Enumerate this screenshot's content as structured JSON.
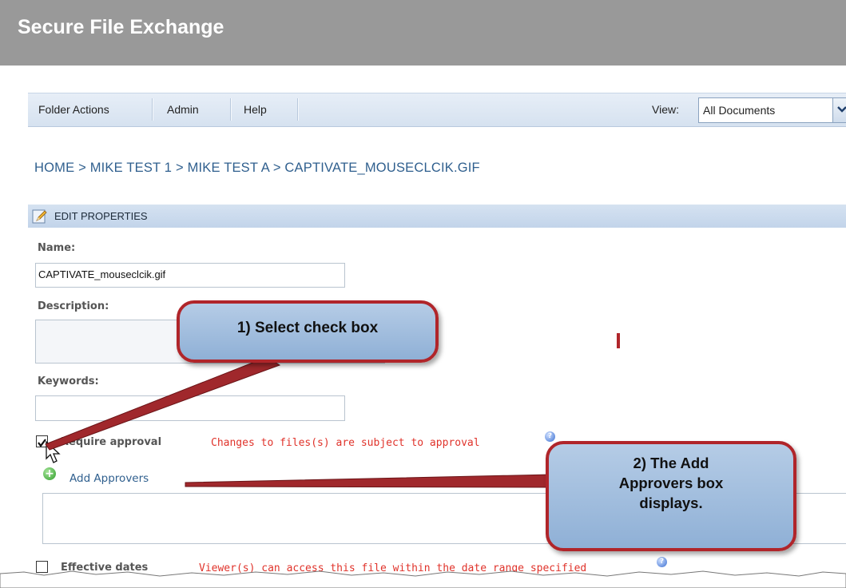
{
  "app": {
    "title": "Secure File Exchange"
  },
  "menu": {
    "items": [
      "Folder Actions",
      "Admin",
      "Help"
    ]
  },
  "view": {
    "label": "View:",
    "selected": "All Documents"
  },
  "breadcrumb": "HOME > MIKE TEST 1 > MIKE TEST A > CAPTIVATE_MOUSECLCIK.GIF",
  "section": {
    "title": "EDIT PROPERTIES"
  },
  "form": {
    "name_label": "Name:",
    "name_value": "CAPTIVATE_mouseclcik.gif",
    "description_label": "Description:",
    "keywords_label": "Keywords:",
    "require_approval_label": "Require approval",
    "require_approval_checked": true,
    "require_approval_note": "Changes to files(s) are subject to approval",
    "add_approvers_label": "Add Approvers",
    "effective_dates_label": "Effective dates",
    "effective_dates_checked": false,
    "effective_dates_note": "Viewer(s) can access this file within the date range specified"
  },
  "callouts": {
    "one": "1) Select check box",
    "two_line1": "2) The Add",
    "two_line2": "Approvers box",
    "two_line3": "displays."
  },
  "colors": {
    "accent": "#2f5f8e",
    "alert": "#e0332b",
    "callout_border": "#b0252a"
  }
}
